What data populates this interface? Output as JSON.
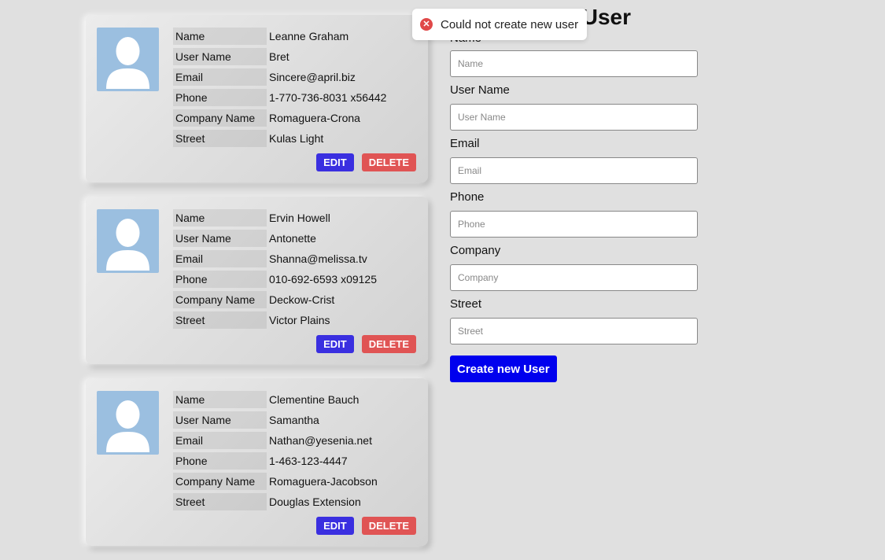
{
  "field_labels": {
    "name": "Name",
    "username": "User Name",
    "email": "Email",
    "phone": "Phone",
    "company": "Company Name",
    "street": "Street"
  },
  "buttons": {
    "edit": "EDIT",
    "delete": "DELETE"
  },
  "users": [
    {
      "name": "Leanne Graham",
      "username": "Bret",
      "email": "Sincere@april.biz",
      "phone": "1-770-736-8031 x56442",
      "company": "Romaguera-Crona",
      "street": "Kulas Light"
    },
    {
      "name": "Ervin Howell",
      "username": "Antonette",
      "email": "Shanna@melissa.tv",
      "phone": "010-692-6593 x09125",
      "company": "Deckow-Crist",
      "street": "Victor Plains"
    },
    {
      "name": "Clementine Bauch",
      "username": "Samantha",
      "email": "Nathan@yesenia.net",
      "phone": "1-463-123-4447",
      "company": "Romaguera-Jacobson",
      "street": "Douglas Extension"
    }
  ],
  "form": {
    "title": "User",
    "name_label": "Name",
    "name_placeholder": "Name",
    "username_label": "User Name",
    "username_placeholder": "User Name",
    "email_label": "Email",
    "email_placeholder": "Email",
    "phone_label": "Phone",
    "phone_placeholder": "Phone",
    "company_label": "Company",
    "company_placeholder": "Company",
    "street_label": "Street",
    "street_placeholder": "Street",
    "submit_label": "Create new User"
  },
  "toast": {
    "icon": "error-icon",
    "message": "Could not create new user"
  },
  "colors": {
    "edit_button": "#3a2fe0",
    "delete_button": "#e05454",
    "create_button": "#0000ee",
    "error": "#e04848",
    "avatar_bg": "#9bbfe0"
  }
}
